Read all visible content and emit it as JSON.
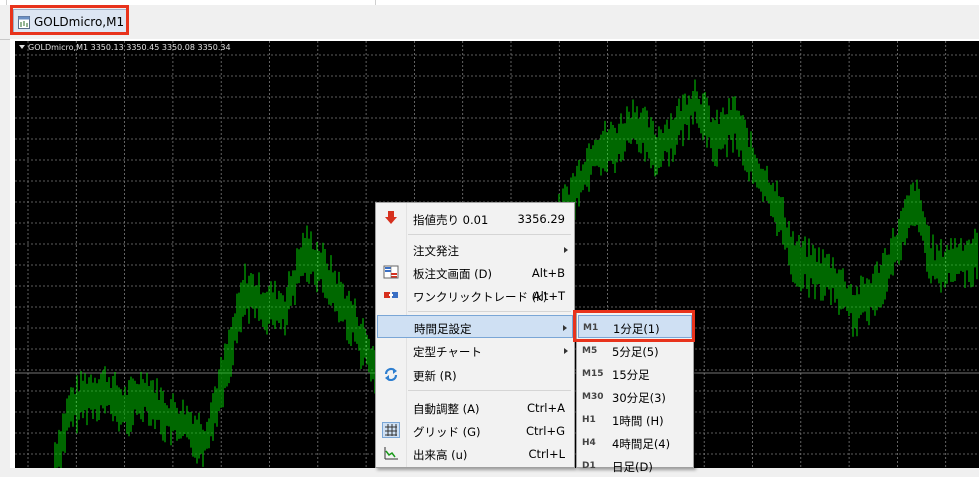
{
  "window": {
    "tab_title": "GOLDmicro,M1"
  },
  "chart": {
    "info_line": "GOLDmicro,M1  3350.13 3350.45 3350.08 3350.34",
    "colors": {
      "background": "#000000",
      "candles": "#00d000",
      "grid": "#7a7a7a"
    }
  },
  "context_menu": {
    "items": [
      {
        "label": "指値売り 0.01",
        "shortcut": "3356.29",
        "icon": "sell-arrow-icon"
      },
      {
        "label": "注文発注",
        "submenu": true
      },
      {
        "label": "板注文画面 (D)",
        "shortcut": "Alt+B",
        "icon": "depth-of-market-icon"
      },
      {
        "label": "ワンクリックトレード (k)",
        "shortcut": "Alt+T",
        "icon": "one-click-trade-icon"
      },
      {
        "label": "時間足設定",
        "submenu": true,
        "highlighted": true
      },
      {
        "label": "定型チャート",
        "submenu": true
      },
      {
        "label": "更新 (R)",
        "icon": "refresh-icon"
      },
      {
        "label": "自動調整 (A)",
        "shortcut": "Ctrl+A"
      },
      {
        "label": "グリッド (G)",
        "shortcut": "Ctrl+G",
        "icon": "grid-icon"
      },
      {
        "label": "出来高 (u)",
        "shortcut": "Ctrl+L",
        "icon": "volume-icon"
      }
    ]
  },
  "timeframe_submenu": {
    "items": [
      {
        "code": "M1",
        "label": "1分足(1)",
        "highlighted": true
      },
      {
        "code": "M5",
        "label": "5分足(5)"
      },
      {
        "code": "M15",
        "label": "15分足"
      },
      {
        "code": "M30",
        "label": "30分足(3)"
      },
      {
        "code": "H1",
        "label": "1時間 (H)"
      },
      {
        "code": "H4",
        "label": "4時間足(4)"
      },
      {
        "code": "D1",
        "label": "日足(D)"
      }
    ]
  }
}
